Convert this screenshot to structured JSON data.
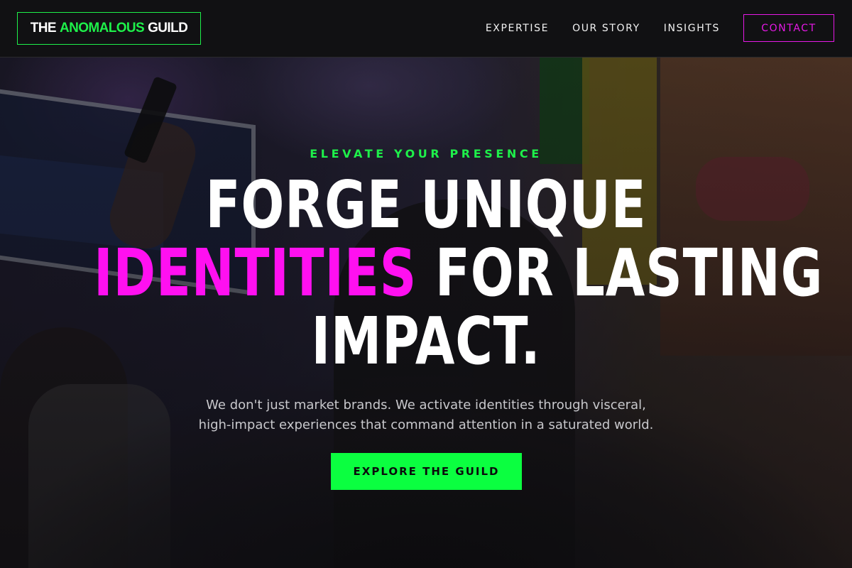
{
  "header": {
    "logo": {
      "part1": "THE",
      "part2": "ANOMALOUS",
      "part3": "GUILD"
    },
    "nav": [
      {
        "label": "EXPERTISE"
      },
      {
        "label": "OUR STORY"
      },
      {
        "label": "INSIGHTS"
      }
    ],
    "contact_label": "CONTACT"
  },
  "hero": {
    "eyebrow": "ELEVATE YOUR PRESENCE",
    "headline": {
      "line1": "FORGE UNIQUE",
      "line2_highlight": "IDENTITIES",
      "line2_rest": " FOR LASTING",
      "line3": "IMPACT."
    },
    "subtext": {
      "line1": "We don't just market brands. We activate identities through visceral,",
      "line2": "high-impact experiences that command attention in a saturated world."
    },
    "cta_label": "EXPLORE THE GUILD",
    "background_image": "event crowd photo (darkened)"
  },
  "colors": {
    "accent_green": "#1ef04a",
    "accent_magenta": "#ff10f0",
    "cta_green": "#0bff40",
    "background": "#0b0b0c"
  }
}
